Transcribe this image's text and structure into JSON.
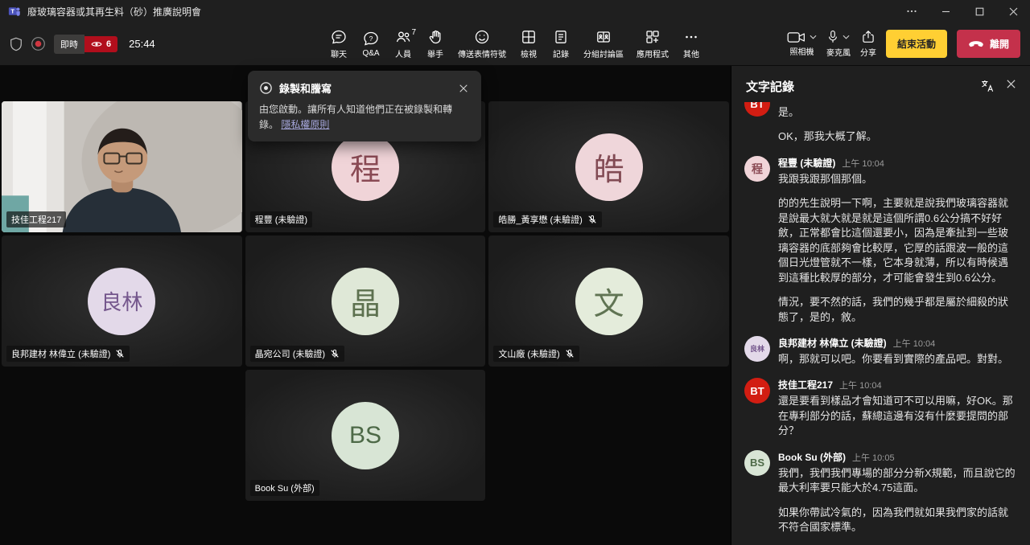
{
  "titlebar": {
    "title": "廢玻璃容器或其再生料（砂）推廣說明會"
  },
  "toolbar": {
    "live_badge": "即時",
    "viewer_count": "6",
    "timer": "25:44",
    "buttons": [
      {
        "key": "chat",
        "icon": "chat",
        "label": "聊天"
      },
      {
        "key": "qa",
        "icon": "qa",
        "label": "Q&A"
      },
      {
        "key": "people",
        "icon": "people",
        "label": "人員",
        "badge": "7"
      },
      {
        "key": "raise-hand",
        "icon": "hand",
        "label": "舉手"
      },
      {
        "key": "reactions",
        "icon": "emoji",
        "label": "傳送表情符號"
      },
      {
        "key": "view",
        "icon": "view",
        "label": "檢視"
      },
      {
        "key": "notes",
        "icon": "notes",
        "label": "記錄"
      },
      {
        "key": "breakout-rooms",
        "icon": "rooms",
        "label": "分組討論區"
      },
      {
        "key": "apps",
        "icon": "apps",
        "label": "應用程式"
      },
      {
        "key": "more",
        "icon": "more",
        "label": "其他"
      }
    ],
    "camera_label": "照相機",
    "mic_label": "麥克風",
    "share_label": "分享",
    "end_event_label": "結束活動",
    "leave_label": "離開"
  },
  "notification": {
    "title": "錄製和謄寫",
    "body": "由您啟動。讓所有人知道他們正在被錄製和轉錄。",
    "privacy_link": "隱私權原則"
  },
  "participants": [
    {
      "key": "jijia",
      "name": "技佳工程217",
      "type": "video",
      "muted": false
    },
    {
      "key": "chengfeng",
      "name": "程豐 (未驗證)",
      "type": "avatar",
      "initials": "程",
      "bg": "#f0d4d8",
      "fg": "#8a4a54",
      "muted": false
    },
    {
      "key": "haosheng",
      "name": "皓勝_黃享懋 (未驗證)",
      "type": "avatar",
      "initials": "皓",
      "bg": "#efd6da",
      "fg": "#824b54",
      "muted": true
    },
    {
      "key": "liangbang",
      "name": "良邦建材 林偉立 (未驗證)",
      "type": "avatar",
      "initials": "良林",
      "bg": "#e3d9e9",
      "fg": "#74568c",
      "muted": true
    },
    {
      "key": "jingwan",
      "name": "晶宛公司 (未驗證)",
      "type": "avatar",
      "initials": "晶",
      "bg": "#dfe8d7",
      "fg": "#5d714f",
      "muted": true
    },
    {
      "key": "wenshan",
      "name": "文山廠 (未驗證)",
      "type": "avatar",
      "initials": "文",
      "bg": "#e4ecdb",
      "fg": "#607453",
      "muted": true
    },
    {
      "key": "booksu",
      "name": "Book Su (外部)",
      "type": "avatar",
      "initials": "BS",
      "bg": "#d8e5d5",
      "fg": "#4d6947",
      "muted": false,
      "col": 2
    }
  ],
  "transcript": {
    "title": "文字記錄",
    "messages": [
      {
        "continuation": true,
        "avatar": {
          "text": "BT",
          "bg": "#d21d12",
          "fg": "#ffffff"
        },
        "name": "",
        "time": "",
        "paragraphs": [
          "是。",
          "OK，那我大概了解。"
        ]
      },
      {
        "avatar": {
          "text": "程",
          "bg": "#f0d4d8",
          "fg": "#8a4a54"
        },
        "name": "程豐 (未驗證)",
        "time": "上午 10:04",
        "paragraphs": [
          "我跟我跟那個那個。",
          "的的先生說明一下啊，主要就是說我們玻璃容器就是說最大就大就是就是這個所謂0.6公分搞不好好斂，正常都會比這個還要小，因為是牽扯到一些玻璃容器的底部夠會比較厚，它厚的話跟波一般的這個日光燈管就不一樣，它本身就薄，所以有時候遇到這種比較厚的部分，才可能會發生到0.6公分。",
          "情況，要不然的話，我們的幾乎都是屬於細殺的狀態了，是的，敘。"
        ]
      },
      {
        "avatar": {
          "text": "良林",
          "bg": "#e3d9e9",
          "fg": "#74568c"
        },
        "name": "良邦建材 林偉立 (未驗證)",
        "time": "上午 10:04",
        "paragraphs": [
          "啊，那就可以吧。你要看到實際的產品吧。對對。"
        ]
      },
      {
        "avatar": {
          "text": "BT",
          "bg": "#d21d12",
          "fg": "#ffffff"
        },
        "name": "技佳工程217",
        "time": "上午 10:04",
        "paragraphs": [
          "還是要看到樣品才會知道可不可以用嘛，好OK。那在專利部分的話，蘇總這邊有沒有什麼要提問的部分？"
        ]
      },
      {
        "avatar": {
          "text": "BS",
          "bg": "#d8e5d5",
          "fg": "#4d6947"
        },
        "name": "Book Su (外部)",
        "time": "上午 10:05",
        "paragraphs": [
          "我們，我們我們專場的部分分新X規範，而且說它的最大利率要只能大於4.75這面。",
          "如果你帶試冷氣的，因為我們就如果我們家的話就不符合國家標準。"
        ]
      }
    ]
  }
}
